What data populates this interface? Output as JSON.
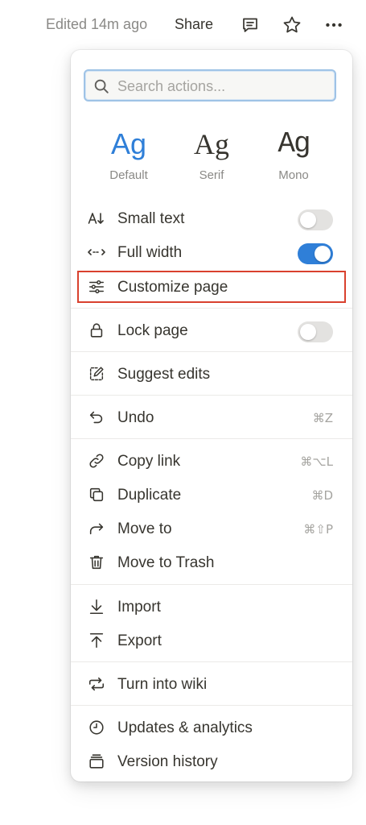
{
  "topbar": {
    "edited": "Edited 14m ago",
    "share": "Share",
    "icons": [
      "comment-icon",
      "star-icon",
      "more-icon"
    ]
  },
  "menu": {
    "search_placeholder": "Search actions...",
    "fonts": [
      {
        "sample": "Ag",
        "name": "Default",
        "selected": true
      },
      {
        "sample": "Ag",
        "name": "Serif",
        "selected": false
      },
      {
        "sample": "Ag",
        "name": "Mono",
        "selected": false
      }
    ],
    "items": {
      "small_text": {
        "label": "Small text",
        "icon": "a-down-icon",
        "toggle": false
      },
      "full_width": {
        "label": "Full width",
        "icon": "arrows-horizontal-icon",
        "toggle": true
      },
      "customize_page": {
        "label": "Customize page",
        "icon": "sliders-icon"
      },
      "lock_page": {
        "label": "Lock page",
        "icon": "lock-icon",
        "toggle": false
      },
      "suggest_edits": {
        "label": "Suggest edits",
        "icon": "pencil-square-icon"
      },
      "undo": {
        "label": "Undo",
        "icon": "undo-icon",
        "shortcut": "⌘Z"
      },
      "copy_link": {
        "label": "Copy link",
        "icon": "link-icon",
        "shortcut": "⌘⌥L"
      },
      "duplicate": {
        "label": "Duplicate",
        "icon": "duplicate-icon",
        "shortcut": "⌘D"
      },
      "move_to": {
        "label": "Move to",
        "icon": "arrow-turn-icon",
        "shortcut": "⌘⇧P"
      },
      "move_to_trash": {
        "label": "Move to Trash",
        "icon": "trash-icon"
      },
      "import": {
        "label": "Import",
        "icon": "import-icon"
      },
      "export": {
        "label": "Export",
        "icon": "export-icon"
      },
      "turn_into_wiki": {
        "label": "Turn into wiki",
        "icon": "cycle-arrows-icon"
      },
      "updates_analytics": {
        "label": "Updates & analytics",
        "icon": "clock-icon"
      },
      "version_history": {
        "label": "Version history",
        "icon": "stack-icon"
      }
    }
  },
  "colors": {
    "accent": "#2f7fd8",
    "highlight_border": "#d9412e",
    "text": "#37352f",
    "muted": "#8a8986"
  }
}
